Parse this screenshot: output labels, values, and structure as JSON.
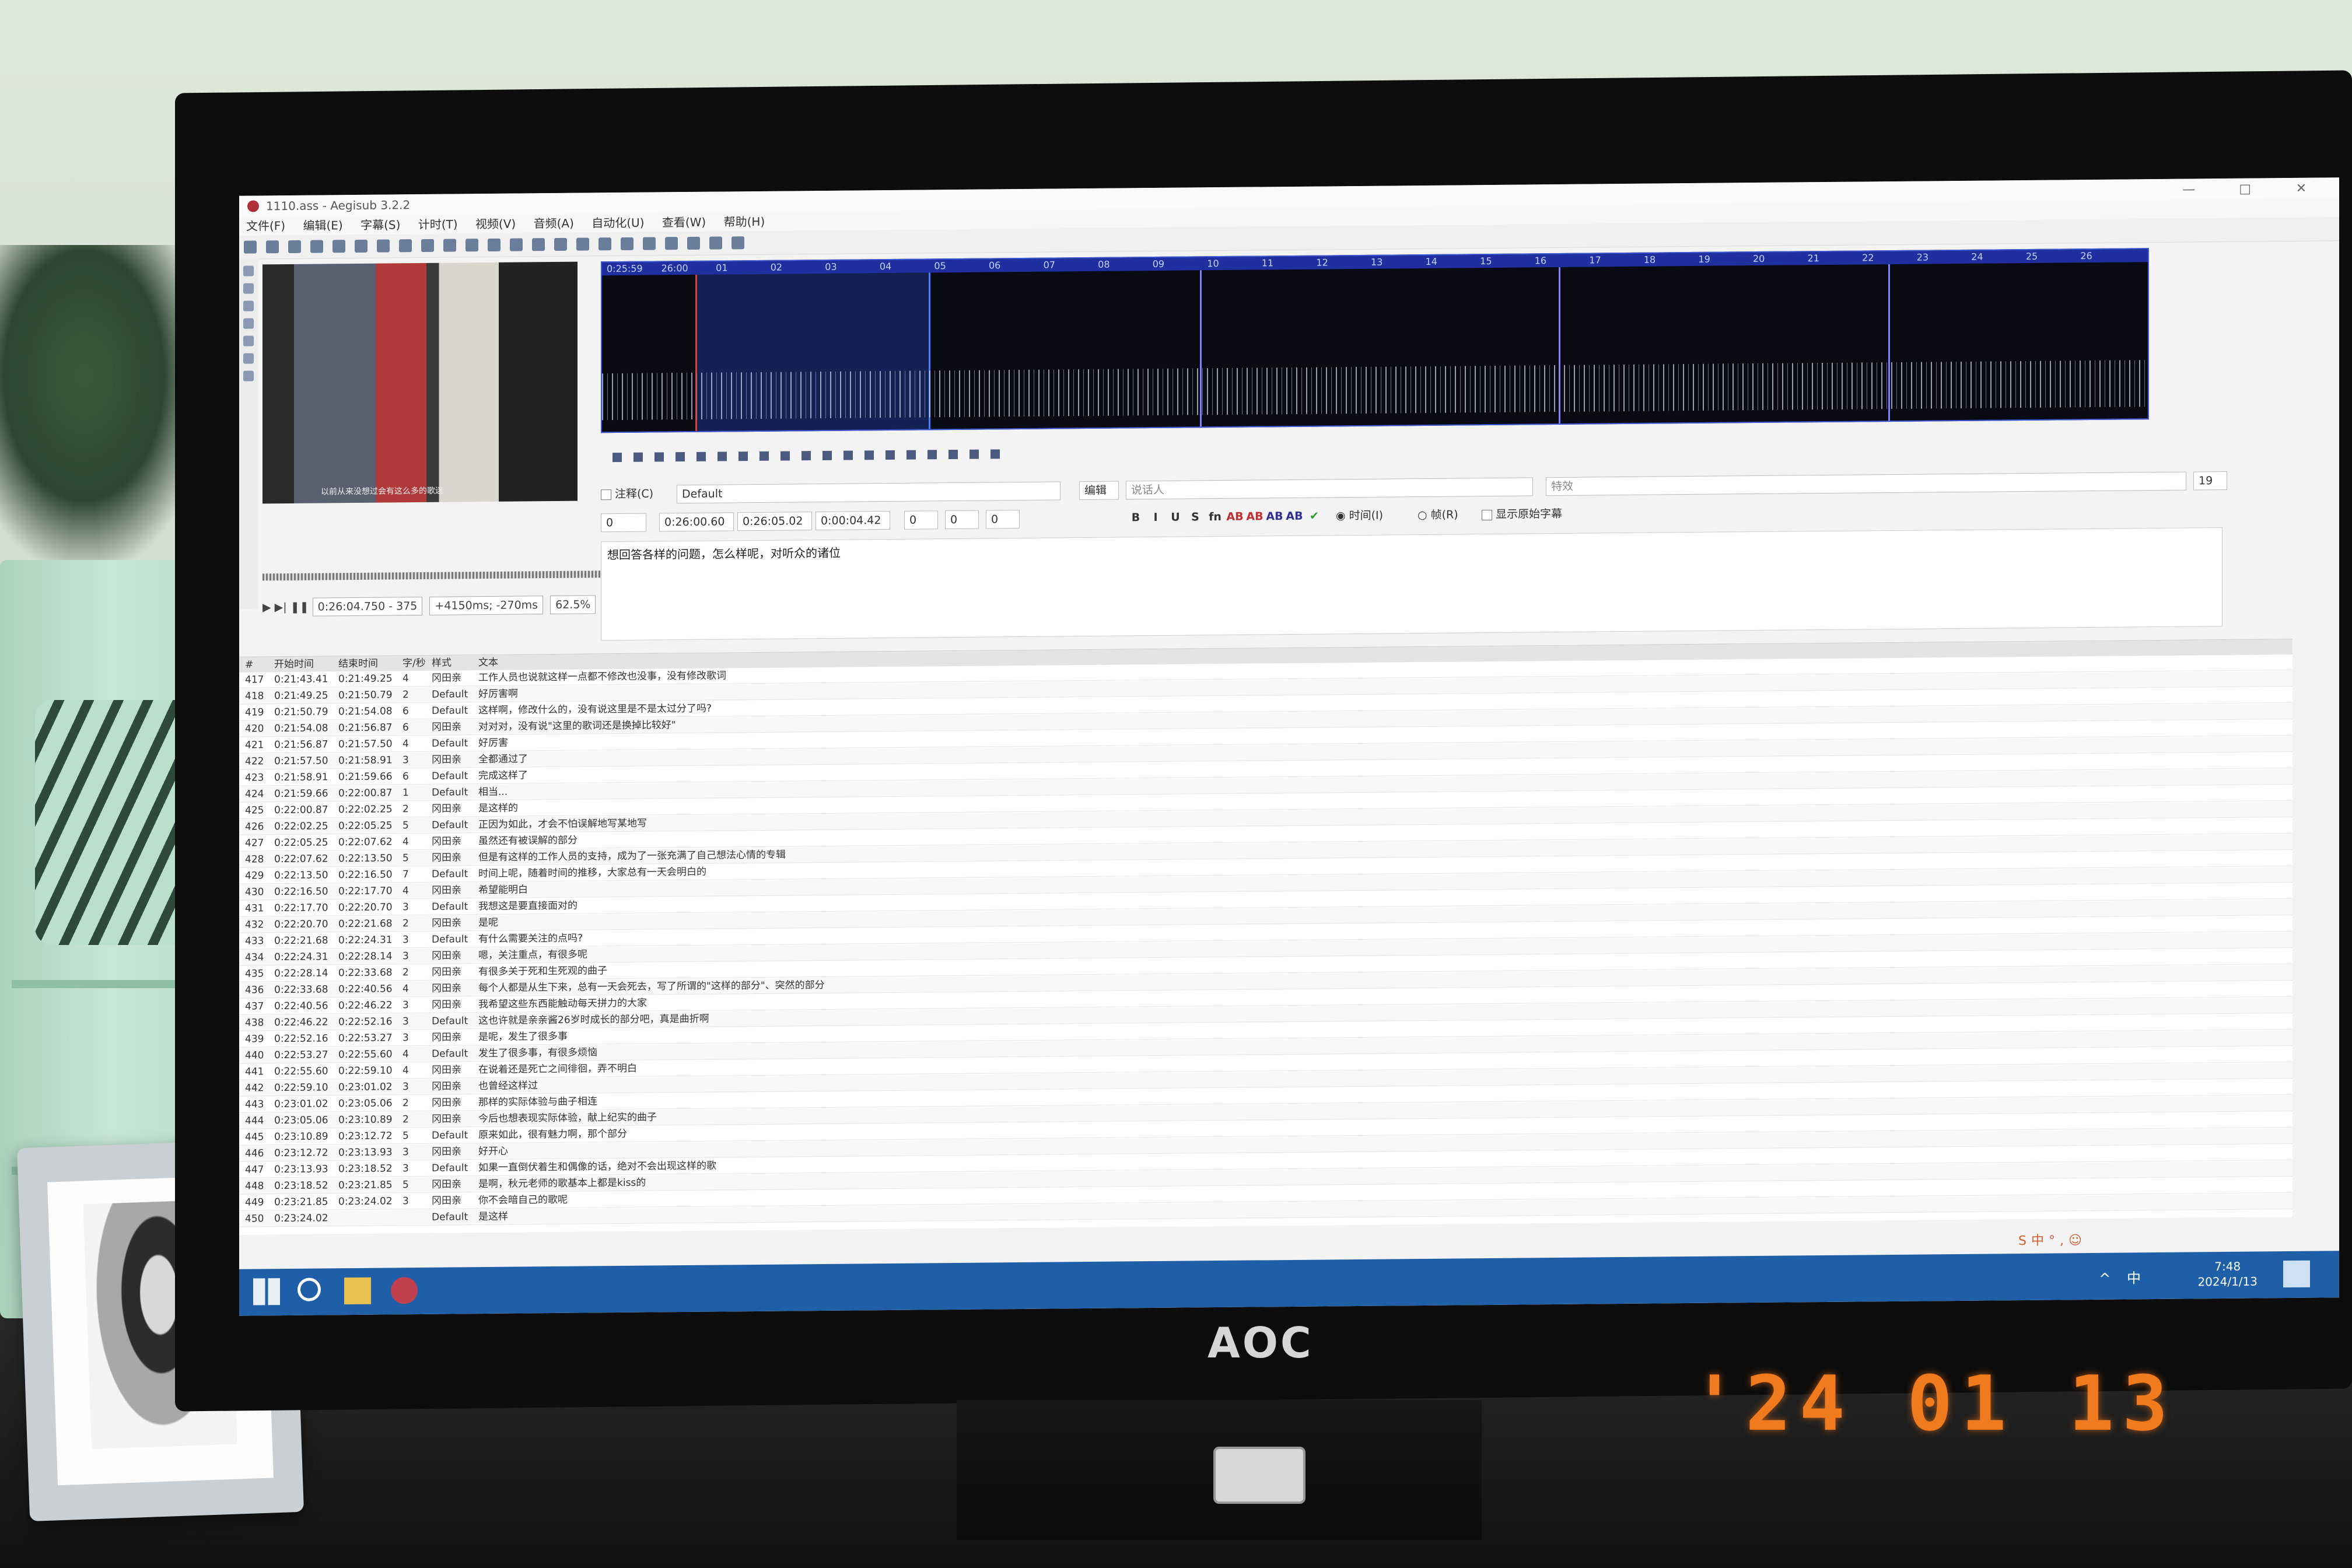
{
  "window": {
    "title": "1110.ass - Aegisub 3.2.2",
    "controls": [
      "—",
      "□",
      "✕"
    ]
  },
  "menu": [
    "文件(F)",
    "编辑(E)",
    "字幕(S)",
    "计时(T)",
    "视频(V)",
    "音频(A)",
    "自动化(U)",
    "查看(W)",
    "帮助(H)"
  ],
  "video": {
    "caption": "以前从来没想过会有这么多的歌迷",
    "time_display": "0:26:04.750 - 375",
    "offset_display": "+4150ms; -270ms",
    "zoom": "62.5%"
  },
  "audio_ruler": [
    "0:25:59",
    "26:00",
    "01",
    "02",
    "03",
    "04",
    "05",
    "06",
    "07",
    "08",
    "09",
    "10",
    "11",
    "12",
    "13",
    "14",
    "15",
    "16",
    "17",
    "18",
    "19",
    "20",
    "21",
    "22",
    "23",
    "24",
    "25",
    "26"
  ],
  "edit": {
    "comment_label": "注释(C)",
    "style": "Default",
    "edit_button": "编辑",
    "actor_placeholder": "说话人",
    "effect_placeholder": "特效",
    "char_count": "19",
    "layer": "0",
    "start": "0:26:00.60",
    "end": "0:26:05.02",
    "duration": "0:00:04.42",
    "margin_l": "0",
    "margin_r": "0",
    "margin_v": "0",
    "format_buttons": [
      "B",
      "I",
      "U",
      "S",
      "fn",
      "AB",
      "AB",
      "AB",
      "AB"
    ],
    "time_radio": "时间(I)",
    "frame_radio": "帧(R)",
    "show_original": "显示原始字幕",
    "text": "想回答各样的问题，怎么样呢，对听众的诸位"
  },
  "grid": {
    "columns": [
      "#",
      "开始时间",
      "结束时间",
      "字/秒",
      "样式",
      "文本"
    ],
    "rows": [
      [
        "417",
        "0:21:43.41",
        "0:21:49.25",
        "4",
        "冈田亲",
        "工作人员也说就这样一点都不修改也没事，没有修改歌词"
      ],
      [
        "418",
        "0:21:49.25",
        "0:21:50.79",
        "2",
        "Default",
        "好厉害啊"
      ],
      [
        "419",
        "0:21:50.79",
        "0:21:54.08",
        "6",
        "Default",
        "这样啊，修改什么的，没有说这里是不是太过分了吗?"
      ],
      [
        "420",
        "0:21:54.08",
        "0:21:56.87",
        "6",
        "冈田亲",
        "对对对，没有说\"这里的歌词还是换掉比较好\""
      ],
      [
        "421",
        "0:21:56.87",
        "0:21:57.50",
        "4",
        "Default",
        "好厉害"
      ],
      [
        "422",
        "0:21:57.50",
        "0:21:58.91",
        "3",
        "冈田亲",
        "全都通过了"
      ],
      [
        "423",
        "0:21:58.91",
        "0:21:59.66",
        "6",
        "Default",
        "完成这样了"
      ],
      [
        "424",
        "0:21:59.66",
        "0:22:00.87",
        "1",
        "Default",
        "相当..."
      ],
      [
        "425",
        "0:22:00.87",
        "0:22:02.25",
        "2",
        "冈田亲",
        "是这样的"
      ],
      [
        "426",
        "0:22:02.25",
        "0:22:05.25",
        "5",
        "Default",
        "正因为如此，才会不怕误解地写某地写"
      ],
      [
        "427",
        "0:22:05.25",
        "0:22:07.62",
        "4",
        "冈田亲",
        "虽然还有被误解的部分"
      ],
      [
        "428",
        "0:22:07.62",
        "0:22:13.50",
        "5",
        "冈田亲",
        "但是有这样的工作人员的支持，成为了一张充满了自己想法心情的专辑"
      ],
      [
        "429",
        "0:22:13.50",
        "0:22:16.50",
        "7",
        "Default",
        "时间上呢，随着时间的推移，大家总有一天会明白的"
      ],
      [
        "430",
        "0:22:16.50",
        "0:22:17.70",
        "4",
        "冈田亲",
        "希望能明白"
      ],
      [
        "431",
        "0:22:17.70",
        "0:22:20.70",
        "3",
        "Default",
        "我想这是要直接面对的"
      ],
      [
        "432",
        "0:22:20.70",
        "0:22:21.68",
        "2",
        "冈田亲",
        "是呢"
      ],
      [
        "433",
        "0:22:21.68",
        "0:22:24.31",
        "3",
        "Default",
        "有什么需要关注的点吗?"
      ],
      [
        "434",
        "0:22:24.31",
        "0:22:28.14",
        "3",
        "冈田亲",
        "嗯，关注重点，有很多呢"
      ],
      [
        "435",
        "0:22:28.14",
        "0:22:33.68",
        "2",
        "冈田亲",
        "有很多关于死和生死观的曲子"
      ],
      [
        "436",
        "0:22:33.68",
        "0:22:40.56",
        "4",
        "冈田亲",
        "每个人都是从生下来，总有一天会死去，写了所谓的\"这样的部分\"、突然的部分"
      ],
      [
        "437",
        "0:22:40.56",
        "0:22:46.22",
        "3",
        "冈田亲",
        "我希望这些东西能触动每天拼力的大家"
      ],
      [
        "438",
        "0:22:46.22",
        "0:22:52.16",
        "3",
        "Default",
        "这也许就是亲亲酱26岁时成长的部分吧，真是曲折啊"
      ],
      [
        "439",
        "0:22:52.16",
        "0:22:53.27",
        "3",
        "冈田亲",
        "是呢，发生了很多事"
      ],
      [
        "440",
        "0:22:53.27",
        "0:22:55.60",
        "4",
        "Default",
        "发生了很多事，有很多烦恼"
      ],
      [
        "441",
        "0:22:55.60",
        "0:22:59.10",
        "4",
        "冈田亲",
        "在说着还是死亡之间徘徊，弄不明白"
      ],
      [
        "442",
        "0:22:59.10",
        "0:23:01.02",
        "3",
        "冈田亲",
        "也曾经这样过"
      ],
      [
        "443",
        "0:23:01.02",
        "0:23:05.06",
        "2",
        "冈田亲",
        "那样的实际体验与曲子相连"
      ],
      [
        "444",
        "0:23:05.06",
        "0:23:10.89",
        "2",
        "冈田亲",
        "今后也想表现实际体验，献上纪实的曲子"
      ],
      [
        "445",
        "0:23:10.89",
        "0:23:12.72",
        "5",
        "Default",
        "原来如此，很有魅力啊，那个部分"
      ],
      [
        "446",
        "0:23:12.72",
        "0:23:13.93",
        "3",
        "冈田亲",
        "好开心"
      ],
      [
        "447",
        "0:23:13.93",
        "0:23:18.52",
        "3",
        "Default",
        "如果一直倒伏着生和偶像的话，绝对不会出现这样的歌"
      ],
      [
        "448",
        "0:23:18.52",
        "0:23:21.85",
        "5",
        "冈田亲",
        "是啊，秋元老师的歌基本上都是kiss的"
      ],
      [
        "449",
        "0:23:21.85",
        "0:23:24.02",
        "3",
        "冈田亲",
        "你不会暗自己的歌呢"
      ],
      [
        "450",
        "0:23:24.02",
        "",
        "",
        "Default",
        "是这样"
      ]
    ]
  },
  "taskbar": {
    "time": "7:48",
    "date": "2024/1/13",
    "tray": "^ 中"
  },
  "ime": "S中°,☺",
  "monitor_brand": "AOC",
  "photo_datestamp": "'24 01 13",
  "colors": {
    "taskbar": "#1f5fa8",
    "audio_bg": "#0a0a14",
    "audio_frame": "#3e58d6",
    "datestamp": "#f07a1e"
  }
}
